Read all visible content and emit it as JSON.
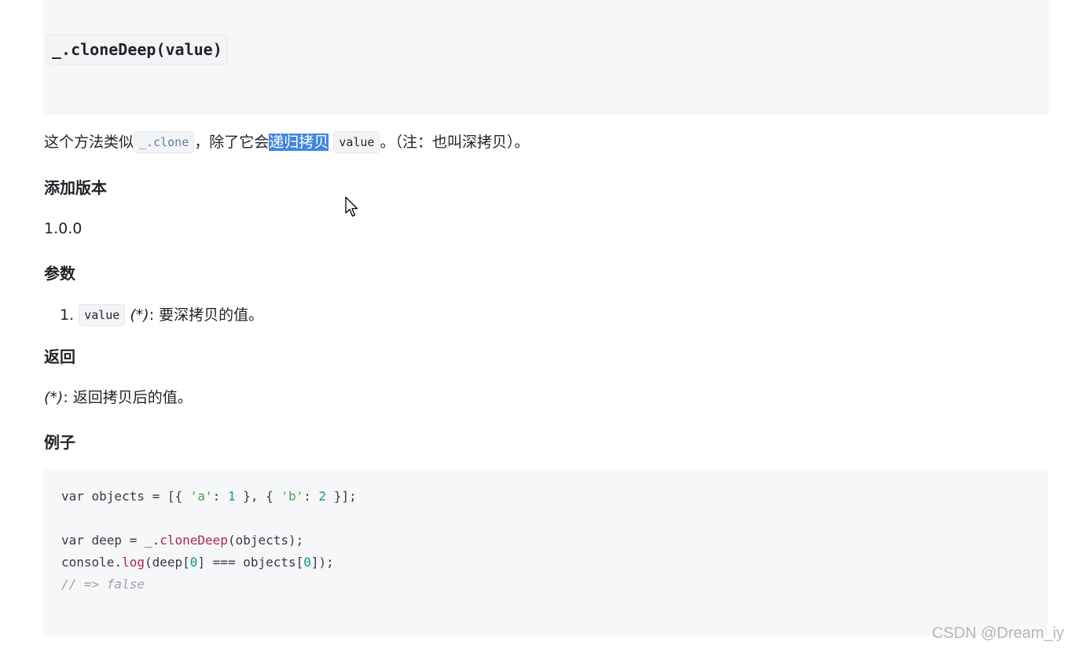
{
  "signature": "_.cloneDeep(value)",
  "description": {
    "before_code": "这个方法类似",
    "clone_code": "_.clone",
    "middle": "，除了它会",
    "selected": "递归拷贝",
    "value_code": "value",
    "after": "。（注：也叫深拷贝）。"
  },
  "version": {
    "heading": "添加版本",
    "value": "1.0.0"
  },
  "arguments": {
    "heading": "参数",
    "items": [
      {
        "number": "1.",
        "name": "value",
        "type": "(*)",
        "desc": ": 要深拷贝的值。"
      }
    ]
  },
  "returns": {
    "heading": "返回",
    "type": "(*)",
    "desc": ": 返回拷贝后的值。"
  },
  "example": {
    "heading": "例子",
    "line1": {
      "a": "var objects = [{ ",
      "s1": "'a'",
      "b": ": ",
      "n1": "1",
      "c": " }, { ",
      "s2": "'b'",
      "d": ": ",
      "n2": "2",
      "e": " }];"
    },
    "line2": {
      "a": "var deep = _.",
      "fn": "cloneDeep",
      "b": "(objects);"
    },
    "line3": {
      "a": "console.",
      "fn": "log",
      "b": "(deep[",
      "n": "0",
      "c": "] === objects[",
      "n2": "0",
      "d": "]);"
    },
    "line4": "// => false"
  },
  "watermark": "CSDN @Dream_iy",
  "icons": {
    "cursor": "mouse-pointer-icon"
  }
}
